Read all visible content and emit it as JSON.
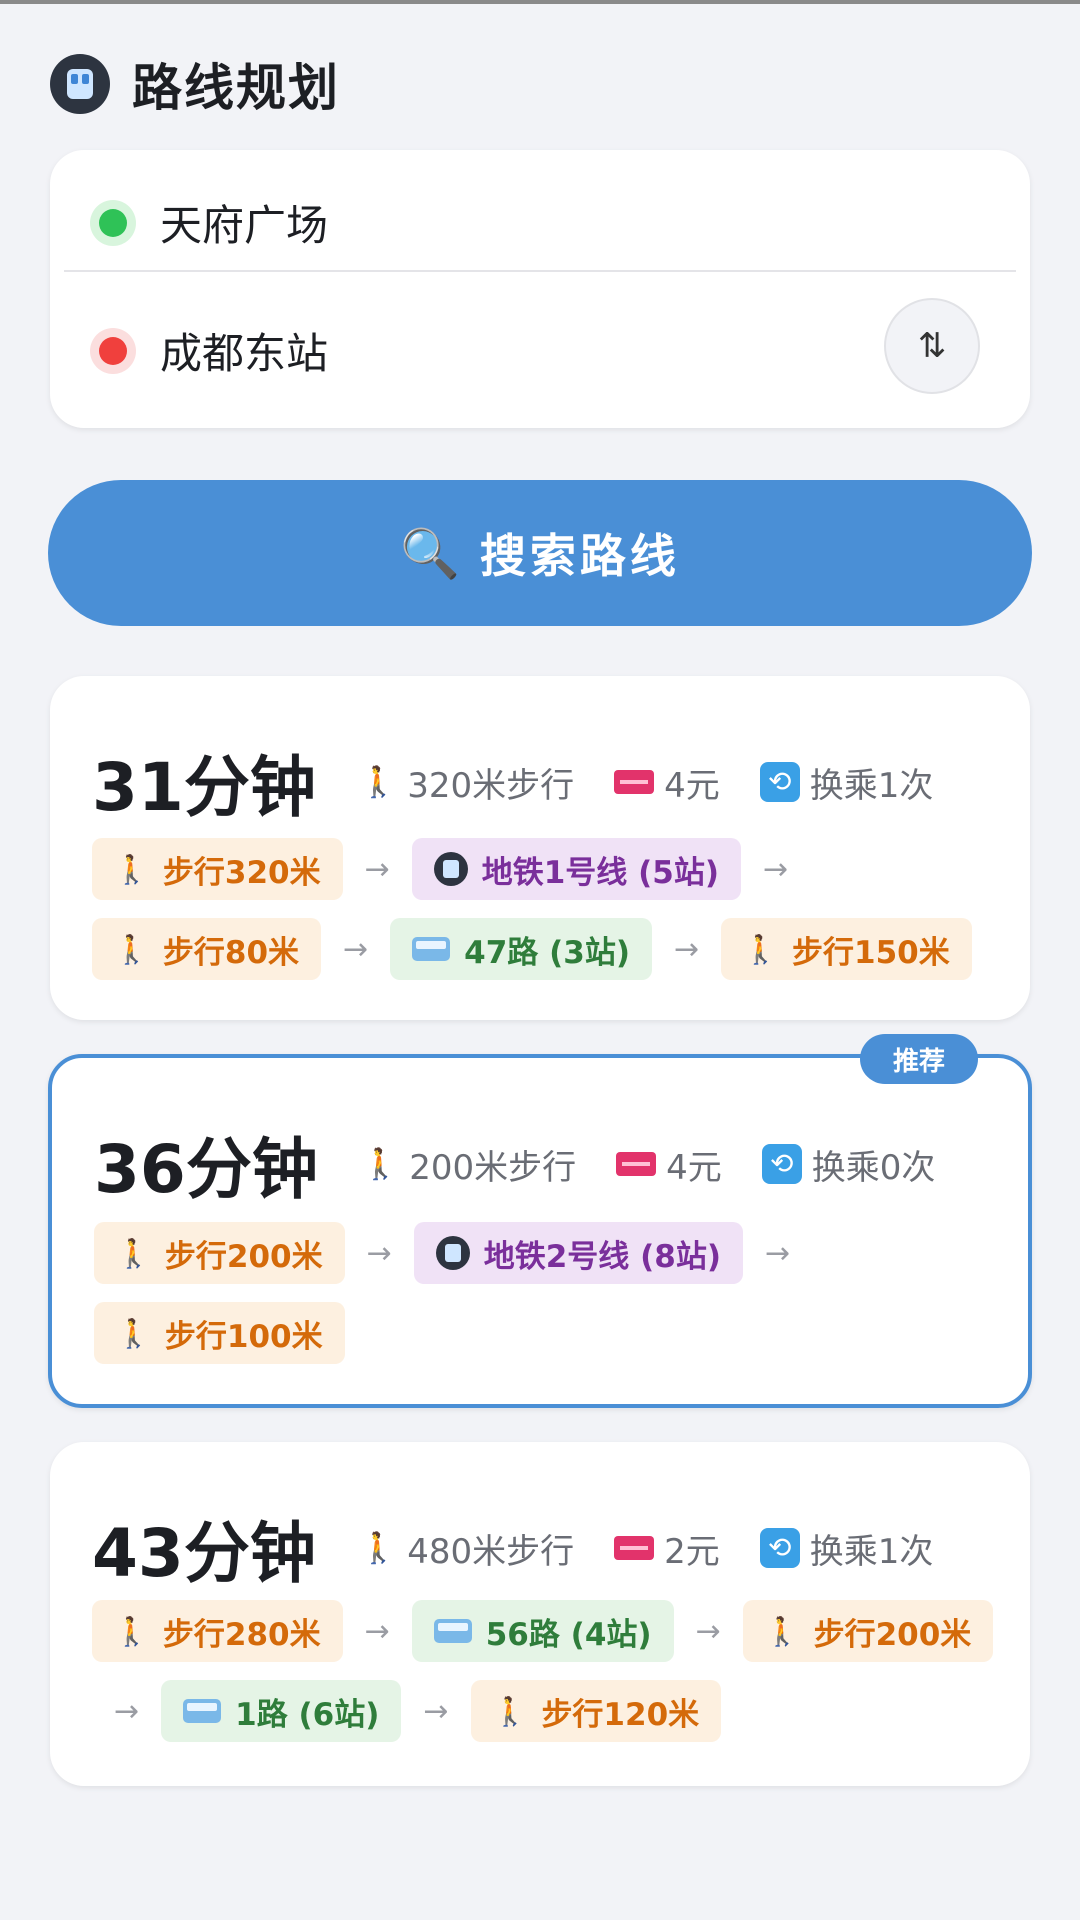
{
  "header": {
    "icon": "metro-icon",
    "title": "路线规划"
  },
  "origin": {
    "value": "天府广场"
  },
  "destination": {
    "value": "成都东站"
  },
  "swap": {
    "label": "⇅"
  },
  "search": {
    "icon": "search-icon",
    "label": "搜索路线"
  },
  "routes": [
    {
      "duration": "31分钟",
      "walk": "320米步行",
      "fare": "4元",
      "transfers": "换乘1次",
      "recommended": false,
      "segments": [
        {
          "type": "walk",
          "label": "步行320米"
        },
        {
          "type": "metro",
          "label": "地铁1号线 (5站)"
        },
        {
          "type": "walk",
          "label": "步行80米"
        },
        {
          "type": "bus",
          "label": "47路 (3站)"
        },
        {
          "type": "walk",
          "label": "步行150米"
        }
      ]
    },
    {
      "duration": "36分钟",
      "walk": "200米步行",
      "fare": "4元",
      "transfers": "换乘0次",
      "recommended": true,
      "badge": "推荐",
      "segments": [
        {
          "type": "walk",
          "label": "步行200米"
        },
        {
          "type": "metro",
          "label": "地铁2号线 (8站)"
        },
        {
          "type": "walk",
          "label": "步行100米"
        }
      ]
    },
    {
      "duration": "43分钟",
      "walk": "480米步行",
      "fare": "2元",
      "transfers": "换乘1次",
      "recommended": false,
      "segments": [
        {
          "type": "walk",
          "label": "步行280米"
        },
        {
          "type": "bus",
          "label": "56路 (4站)"
        },
        {
          "type": "walk",
          "label": "步行200米"
        },
        {
          "type": "bus",
          "label": "1路 (6站)"
        },
        {
          "type": "walk",
          "label": "步行120米"
        }
      ]
    }
  ],
  "colors": {
    "accent": "#4a8fd6",
    "origin": "#2fc257",
    "destination": "#f0403d"
  }
}
